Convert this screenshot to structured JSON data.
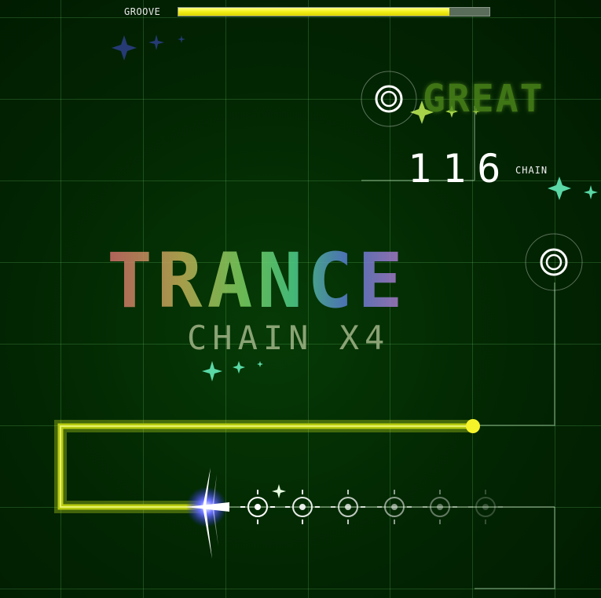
{
  "hud": {
    "groove_label": "GROOVE",
    "groove_level": 0.87,
    "accent_color": "#f3ef18"
  },
  "judgement": {
    "text": "GREAT"
  },
  "chain": {
    "count": "116",
    "label": "CHAIN"
  },
  "banner": {
    "title": "TRANCE",
    "subtitle": "CHAIN X4"
  },
  "icons": [
    "target-ring-icon",
    "sparkle-icon",
    "player-ship-icon",
    "crosshair-note-icon"
  ]
}
